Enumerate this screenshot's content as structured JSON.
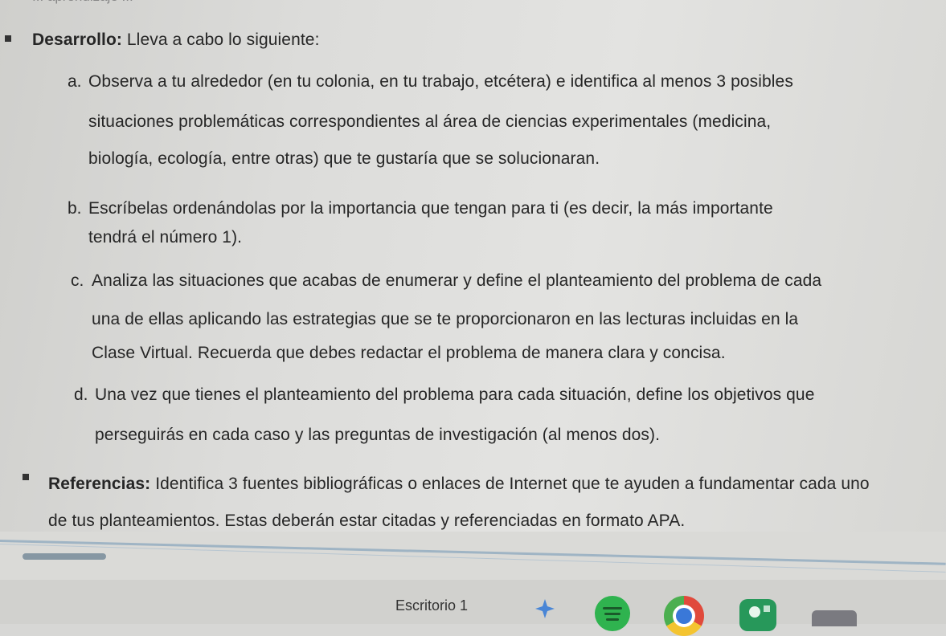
{
  "document": {
    "top_fragment": "... aprendizaje ...",
    "item_desarrollo": {
      "label": "Desarrollo:",
      "text": " Lleva a cabo lo siguiente:"
    },
    "a": {
      "marker": "a.",
      "line1": "Observa a tu alrededor (en tu colonia, en tu trabajo, etcétera) e identifica al menos 3 posibles",
      "line2": "situaciones problemáticas correspondientes al área de ciencias experimentales (medicina,",
      "line3": "biología, ecología, entre otras) que te gustaría que se solucionaran."
    },
    "b": {
      "marker": "b.",
      "line1": "Escríbelas ordenándolas por la importancia que tengan para ti (es decir, la más importante",
      "line2": "tendrá el número 1)."
    },
    "c": {
      "marker": "c.",
      "line1": "Analiza las situaciones que acabas de enumerar y define el planteamiento del problema de cada",
      "line2": "una de ellas aplicando las estrategias que se te proporcionaron en las lecturas incluidas en la",
      "line3": "Clase Virtual. Recuerda que debes redactar el problema de manera clara y concisa."
    },
    "d": {
      "marker": "d.",
      "line1": "Una vez que tienes el planteamiento del problema para cada situación, define los objetivos que",
      "line2": "perseguirás en cada caso y las preguntas de investigación (al menos dos)."
    },
    "item_referencias": {
      "label": "Referencias:",
      "line1": " Identifica 3 fuentes bibliográficas o enlaces de Internet que te ayuden a fundamentar cada uno",
      "line2": "de tus planteamientos. Estas deberán estar citadas y referenciadas en formato APA."
    }
  },
  "taskbar": {
    "desktop_label": "Escritorio 1",
    "icons": [
      "sparkle-icon",
      "spotify-icon",
      "chrome-icon",
      "app-icon",
      "edge-app-icon"
    ]
  }
}
